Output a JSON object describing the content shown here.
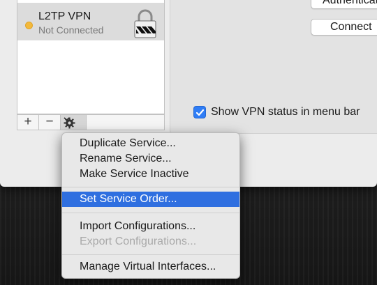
{
  "services": {
    "items": [
      {
        "name": "L2TP VPN",
        "status": "Not Connected",
        "status_color": "#f3b93b"
      }
    ]
  },
  "toolbar": {
    "add_label": "+",
    "remove_label": "−",
    "gear_icon": "gear-icon"
  },
  "buttons": {
    "authenticate_label": "Authenticate...",
    "connect_label": "Connect"
  },
  "checkbox": {
    "label": "Show VPN status in menu bar",
    "checked": true
  },
  "context_menu": {
    "groups": [
      [
        {
          "label": "Duplicate Service...",
          "enabled": true
        },
        {
          "label": "Rename Service...",
          "enabled": true
        },
        {
          "label": "Make Service Inactive",
          "enabled": true
        }
      ],
      [
        {
          "label": "Set Service Order...",
          "enabled": true,
          "highlighted": true
        }
      ],
      [
        {
          "label": "Import Configurations...",
          "enabled": true
        },
        {
          "label": "Export Configurations...",
          "enabled": false
        }
      ],
      [
        {
          "label": "Manage Virtual Interfaces...",
          "enabled": true
        }
      ]
    ]
  },
  "colors": {
    "accent": "#2f6fe0",
    "checkbox": "#2f7df6"
  }
}
